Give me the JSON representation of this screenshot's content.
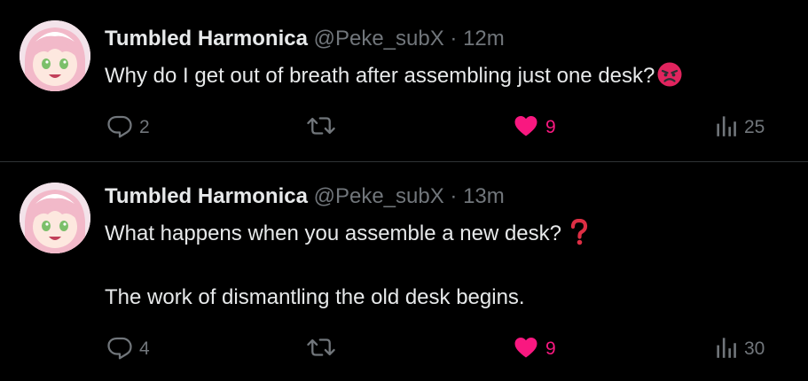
{
  "colors": {
    "background": "#000000",
    "text_primary": "#e7e9ea",
    "text_secondary": "#71767b",
    "like_accent": "#f91880",
    "divider": "#2f3336"
  },
  "tweets": [
    {
      "author": {
        "display_name": "Tumbled Harmonica",
        "handle": "@Peke_subX"
      },
      "separator": "·",
      "time": "12m",
      "text_lines": [
        "Why do I get out of breath after assembling just one desk?"
      ],
      "trailing_emoji": "angry-face-emoji",
      "actions": {
        "reply": {
          "icon": "reply-icon",
          "count": "2"
        },
        "retweet": {
          "icon": "retweet-icon",
          "count": ""
        },
        "like": {
          "icon": "heart-icon",
          "count": "9",
          "liked": true
        },
        "views": {
          "icon": "views-icon",
          "count": "25"
        }
      }
    },
    {
      "author": {
        "display_name": "Tumbled Harmonica",
        "handle": "@Peke_subX"
      },
      "separator": "·",
      "time": "13m",
      "text_lines": [
        "What happens when you assemble a new desk? ",
        "The work of dismantling the old desk begins."
      ],
      "trailing_emoji": "question-mark-emoji",
      "actions": {
        "reply": {
          "icon": "reply-icon",
          "count": "4"
        },
        "retweet": {
          "icon": "retweet-icon",
          "count": ""
        },
        "like": {
          "icon": "heart-icon",
          "count": "9",
          "liked": true
        },
        "views": {
          "icon": "views-icon",
          "count": "30"
        }
      }
    }
  ]
}
